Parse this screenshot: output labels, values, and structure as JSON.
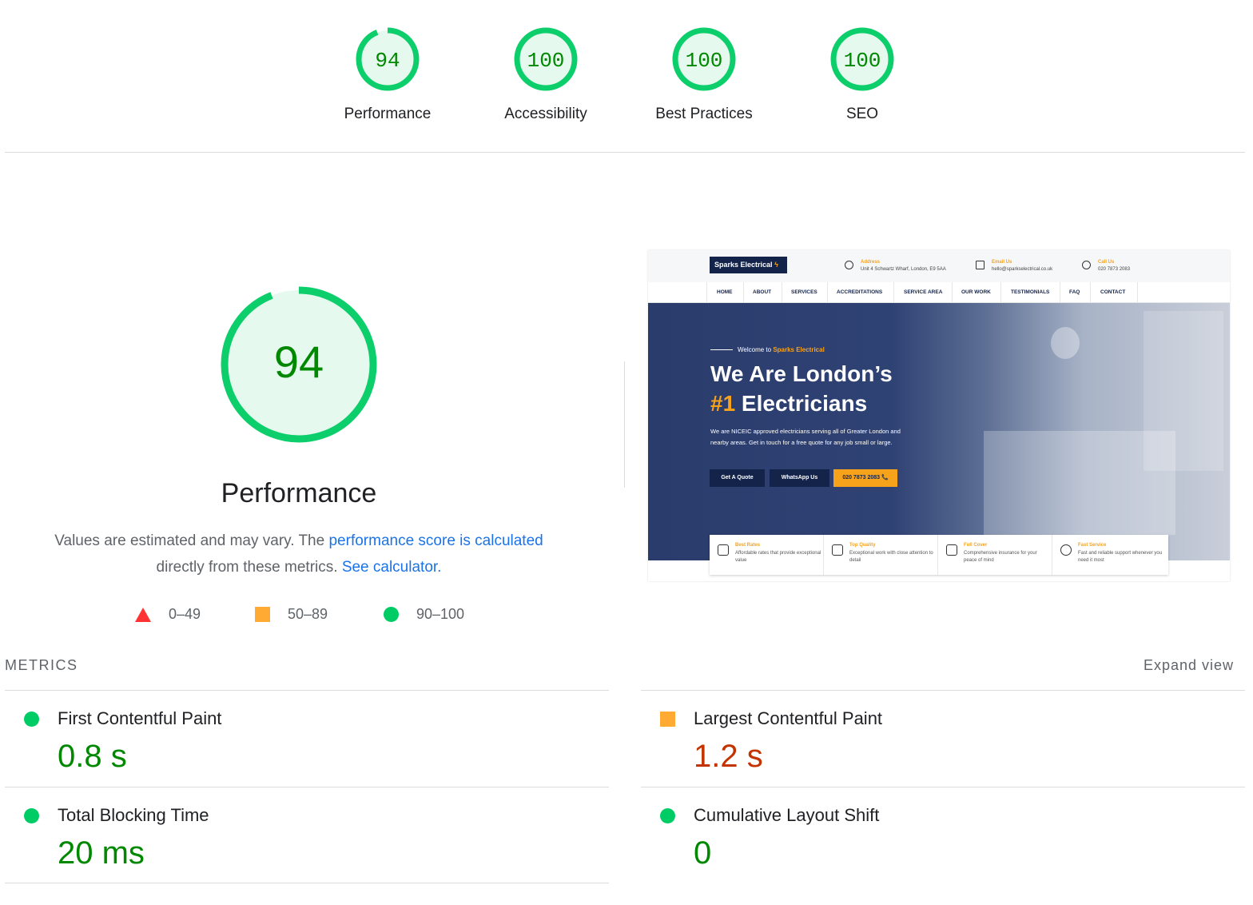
{
  "gauges": [
    {
      "label": "Performance",
      "score": "94",
      "value": 94
    },
    {
      "label": "Accessibility",
      "score": "100",
      "value": 100
    },
    {
      "label": "Best Practices",
      "score": "100",
      "value": 100
    },
    {
      "label": "SEO",
      "score": "100",
      "value": 100
    }
  ],
  "performance": {
    "score": "94",
    "value": 94,
    "title": "Performance",
    "desc_prefix": "Values are estimated and may vary. The ",
    "desc_link1": "performance score is calculated",
    "desc_mid": " directly from these metrics. ",
    "desc_link2": "See calculator.",
    "legend": {
      "fail": "0–49",
      "average": "50–89",
      "pass": "90–100"
    }
  },
  "thumbnail": {
    "logo": "Sparks Electrical",
    "address_label": "Address",
    "address": "Unit 4 Schwartz Wharf, London, E9 5AA",
    "email_label": "Email Us",
    "email": "hello@sparkselectrical.co.uk",
    "call_label": "Call Us",
    "phone": "020 7873 2083",
    "nav": [
      "HOME",
      "ABOUT",
      "SERVICES",
      "ACCREDITATIONS",
      "SERVICE AREA",
      "OUR WORK",
      "TESTIMONIALS",
      "FAQ",
      "CONTACT"
    ],
    "welcome_prefix": "Welcome to ",
    "welcome_brand": "Sparks Electrical",
    "heading_line1": "We Are London’s",
    "heading_number": "#1",
    "heading_line2": " Electricians",
    "paragraph": "We are NICEIC approved electricians serving all of Greater London and nearby areas. Get in touch for a free quote for any job small or large.",
    "btn_quote": "Get A Quote",
    "btn_whatsapp": "WhatsApp Us",
    "btn_phone": "020 7873 2083 📞",
    "features": [
      {
        "title": "Best Rates",
        "desc": "Affordable rates that provide exceptional value"
      },
      {
        "title": "Top Quality",
        "desc": "Exceptional work with close attention to detail"
      },
      {
        "title": "Full Cover",
        "desc": "Comprehensive insurance for your peace of mind"
      },
      {
        "title": "Fast Service",
        "desc": "Fast and reliable support whenever you need it most"
      }
    ]
  },
  "metrics": {
    "header": "METRICS",
    "expand": "Expand view",
    "items": [
      {
        "name": "First Contentful Paint",
        "value": "0.8 s",
        "status": "pass"
      },
      {
        "name": "Largest Contentful Paint",
        "value": "1.2 s",
        "status": "average"
      },
      {
        "name": "Total Blocking Time",
        "value": "20 ms",
        "status": "pass"
      },
      {
        "name": "Cumulative Layout Shift",
        "value": "0",
        "status": "pass"
      }
    ]
  },
  "colors": {
    "pass": "#0cce6b",
    "pass_fill": "#e6f9ee",
    "pass_text": "#008800",
    "average": "#ffa400",
    "average_text": "#c33300",
    "fail": "#ff3333",
    "link": "#1a73e8"
  }
}
